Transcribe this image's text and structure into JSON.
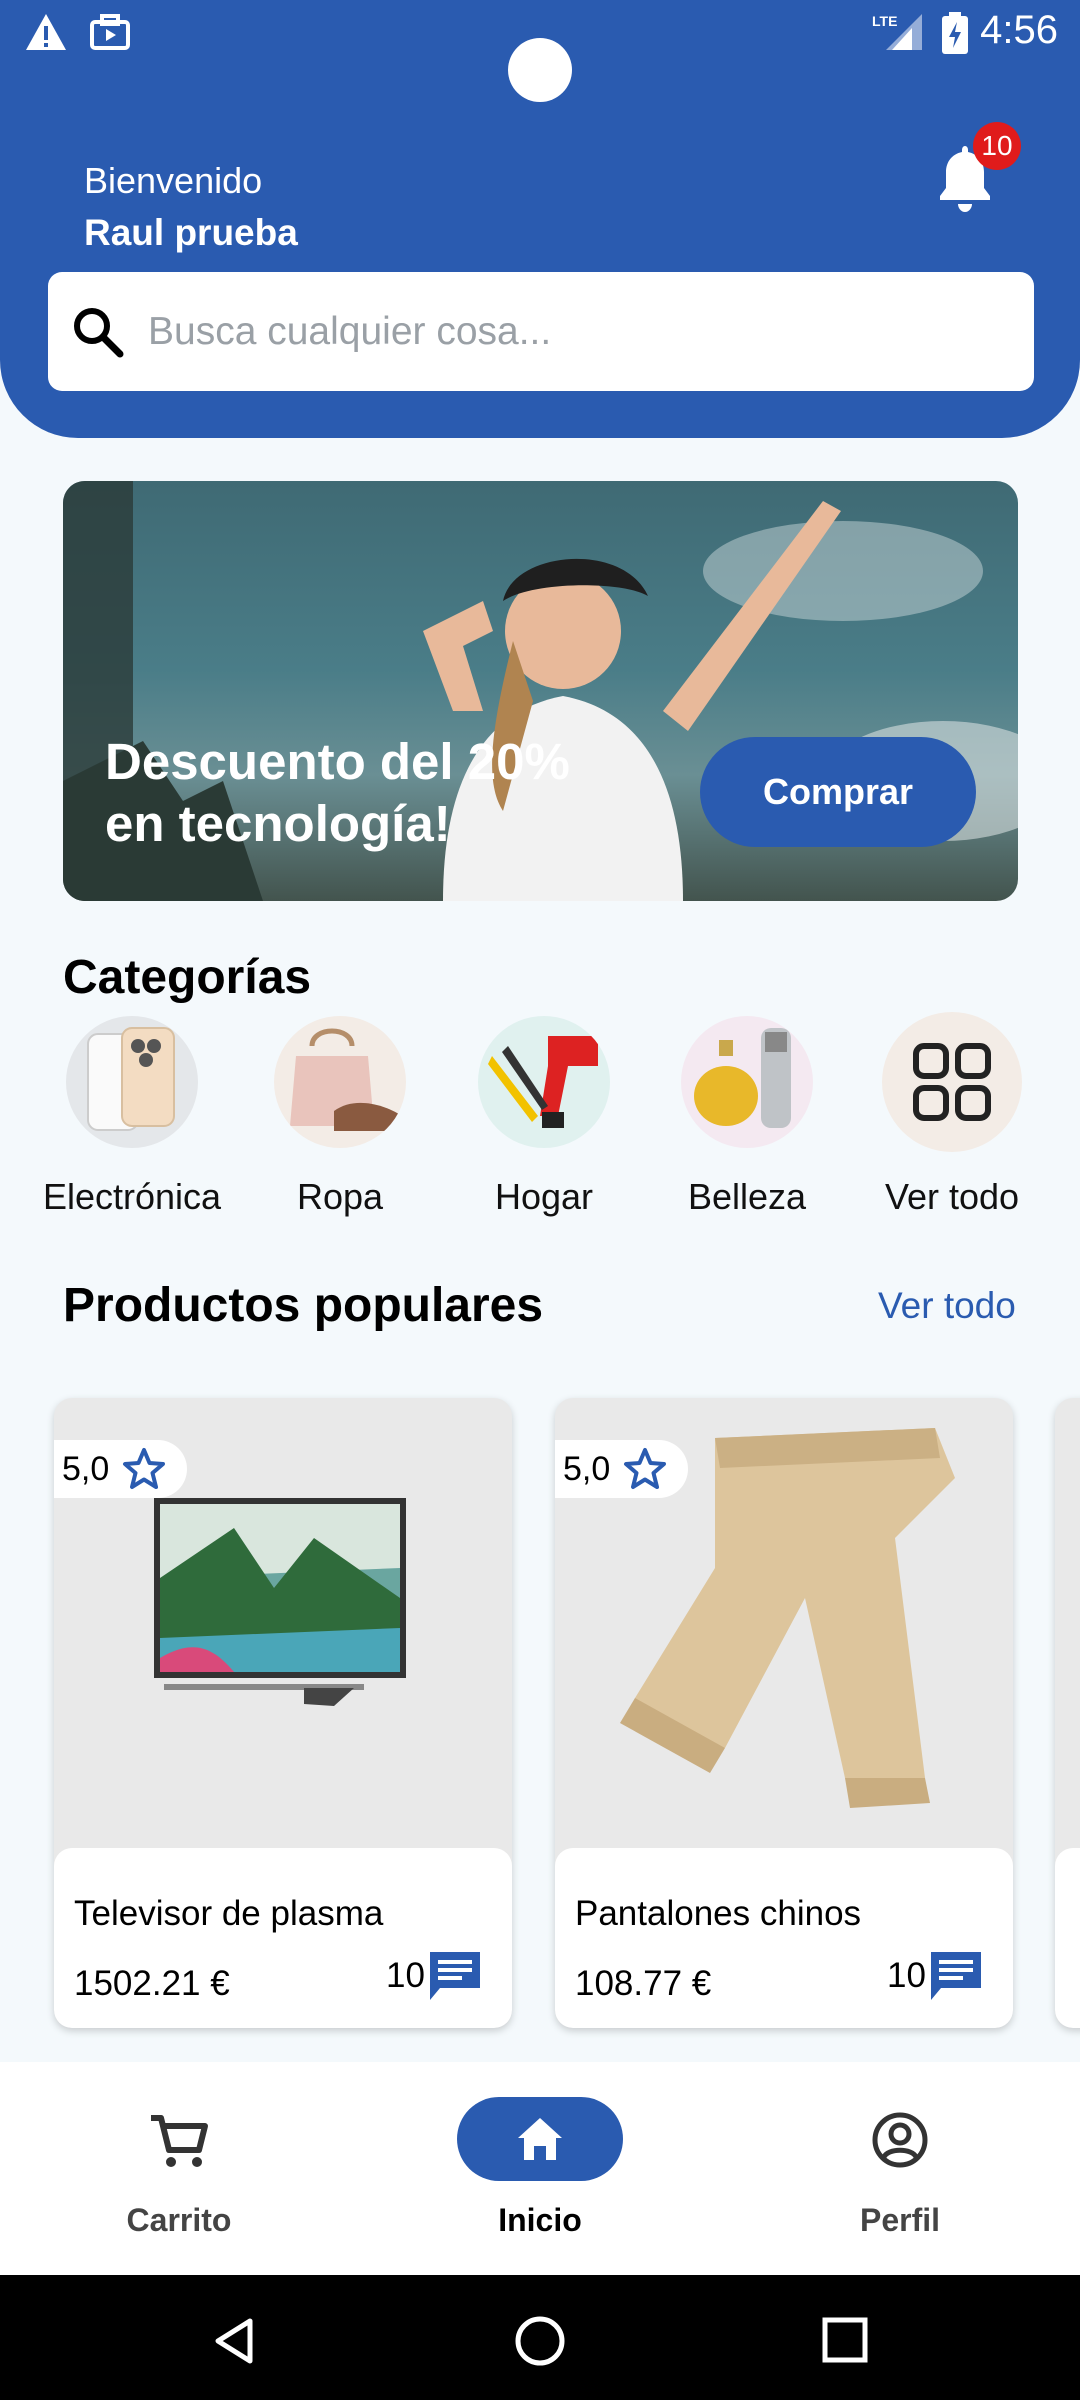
{
  "status": {
    "time": "4:56",
    "network": "LTE"
  },
  "header": {
    "welcome": "Bienvenido",
    "username": "Raul prueba",
    "notification_count": "10",
    "search_placeholder": "Busca cualquier cosa..."
  },
  "banner": {
    "text": "Descuento del 20% en tecnología!",
    "button": "Comprar"
  },
  "categories": {
    "title": "Categorías",
    "items": [
      {
        "label": "Electrónica",
        "icon": "phones-image"
      },
      {
        "label": "Ropa",
        "icon": "bag-shoe-image"
      },
      {
        "label": "Hogar",
        "icon": "tools-image"
      },
      {
        "label": "Belleza",
        "icon": "perfume-razor-image"
      },
      {
        "label": "Ver todo",
        "icon": "grid-icon"
      }
    ]
  },
  "popular": {
    "title": "Productos populares",
    "see_all": "Ver todo",
    "products": [
      {
        "name": "Televisor de plasma",
        "price": "1502.21 €",
        "rating": "5,0",
        "reviews": "10"
      },
      {
        "name": "Pantalones chinos",
        "price": "108.77 €",
        "rating": "5,0",
        "reviews": "10"
      }
    ]
  },
  "nav": {
    "items": [
      {
        "label": "Carrito",
        "icon": "cart-icon"
      },
      {
        "label": "Inicio",
        "icon": "home-icon",
        "active": true
      },
      {
        "label": "Perfil",
        "icon": "profile-icon"
      }
    ]
  },
  "colors": {
    "primary": "#2a5bb0",
    "background": "#f4f9fc",
    "badge": "#e01b1b"
  }
}
